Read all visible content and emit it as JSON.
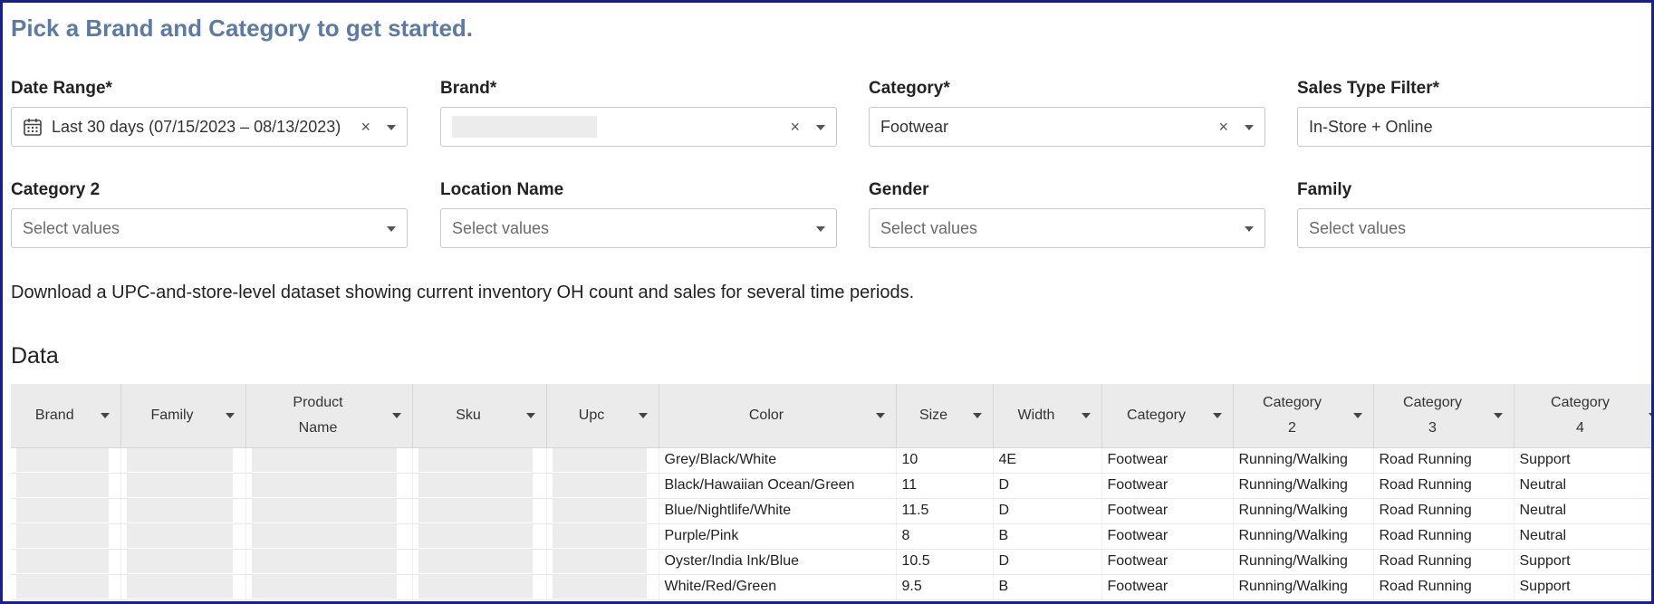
{
  "page": {
    "title": "Pick a Brand and Category to get started.",
    "description": "Download a UPC-and-store-level dataset showing current inventory OH count and sales for several time periods.",
    "data_section_title": "Data"
  },
  "filters": {
    "date_range": {
      "label": "Date Range*",
      "value": "Last 30 days (07/15/2023 – 08/13/2023)",
      "clear": "×"
    },
    "brand": {
      "label": "Brand*",
      "value": "",
      "clear": "×"
    },
    "category": {
      "label": "Category*",
      "value": "Footwear",
      "clear": "×"
    },
    "sales_type": {
      "label": "Sales Type Filter*",
      "value": "In-Store + Online",
      "clear": "×"
    },
    "category2": {
      "label": "Category 2",
      "placeholder": "Select values"
    },
    "location_name": {
      "label": "Location Name",
      "placeholder": "Select values"
    },
    "gender": {
      "label": "Gender",
      "placeholder": "Select values"
    },
    "family": {
      "label": "Family",
      "placeholder": "Select values"
    }
  },
  "table": {
    "columns": [
      [
        "Brand"
      ],
      [
        "Family"
      ],
      [
        "Product",
        "Name"
      ],
      [
        "Sku"
      ],
      [
        "Upc"
      ],
      [
        "Color"
      ],
      [
        "Size"
      ],
      [
        "Width"
      ],
      [
        "Category"
      ],
      [
        "Category",
        "2"
      ],
      [
        "Category",
        "3"
      ],
      [
        "Category",
        "4"
      ]
    ],
    "rows": [
      {
        "color": "Grey/Black/White",
        "size": "10",
        "width": "4E",
        "category": "Footwear",
        "category2": "Running/Walking",
        "category3": "Road Running",
        "category4": "Support"
      },
      {
        "color": "Black/Hawaiian Ocean/Green",
        "size": "11",
        "width": "D",
        "category": "Footwear",
        "category2": "Running/Walking",
        "category3": "Road Running",
        "category4": "Neutral"
      },
      {
        "color": "Blue/Nightlife/White",
        "size": "11.5",
        "width": "D",
        "category": "Footwear",
        "category2": "Running/Walking",
        "category3": "Road Running",
        "category4": "Neutral"
      },
      {
        "color": "Purple/Pink",
        "size": "8",
        "width": "B",
        "category": "Footwear",
        "category2": "Running/Walking",
        "category3": "Road Running",
        "category4": "Neutral"
      },
      {
        "color": "Oyster/India Ink/Blue",
        "size": "10.5",
        "width": "D",
        "category": "Footwear",
        "category2": "Running/Walking",
        "category3": "Road Running",
        "category4": "Support"
      },
      {
        "color": "White/Red/Green",
        "size": "9.5",
        "width": "B",
        "category": "Footwear",
        "category2": "Running/Walking",
        "category3": "Road Running",
        "category4": "Support"
      }
    ]
  },
  "colors": {
    "title": "#5b7aa6",
    "frame": "#1a1f8f",
    "header_bg": "#ebebeb"
  },
  "icons": {
    "date_range": "calendar-icon",
    "clear": "close-icon",
    "dropdown": "chevron-down-icon",
    "sort": "sort-caret-icon"
  }
}
